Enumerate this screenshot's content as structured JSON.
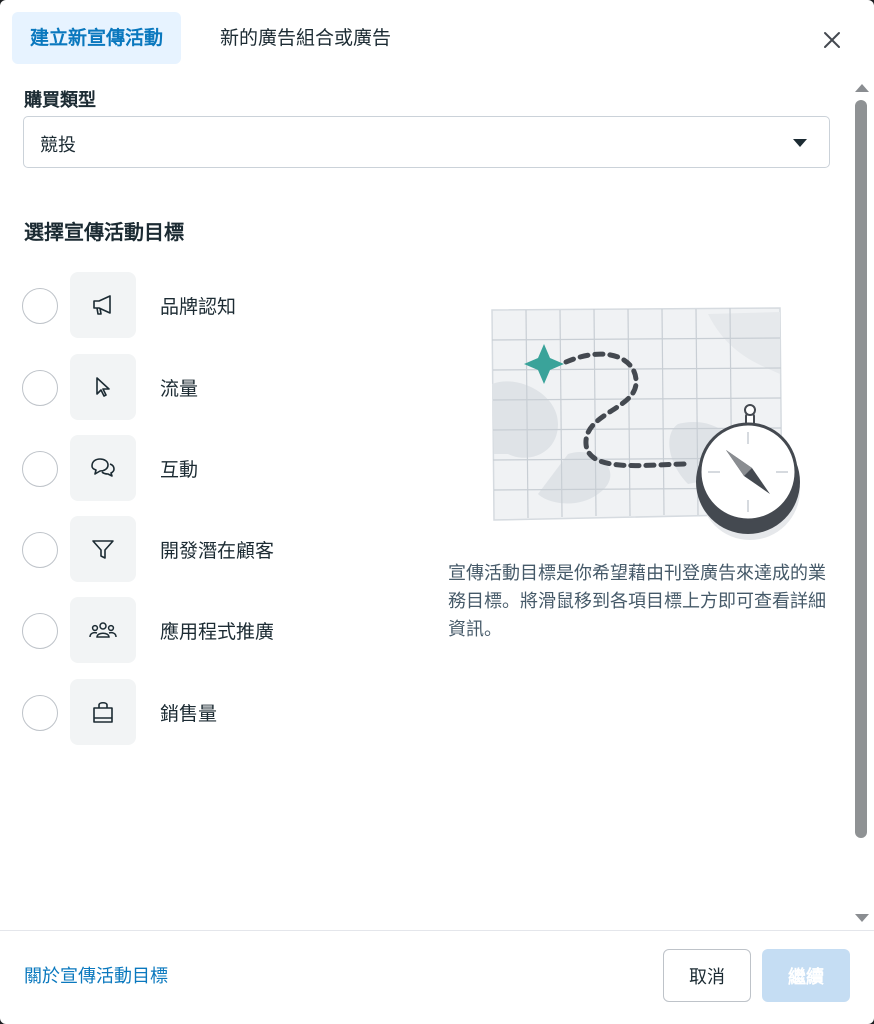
{
  "header": {
    "tabs": [
      {
        "label": "建立新宣傳活動",
        "active": true
      },
      {
        "label": "新的廣告組合或廣告",
        "active": false
      }
    ],
    "close_icon": "close-icon"
  },
  "buying_type": {
    "label": "購買類型",
    "value": "競投"
  },
  "objectives": {
    "heading": "選擇宣傳活動目標",
    "items": [
      {
        "label": "品牌認知",
        "icon": "megaphone-icon"
      },
      {
        "label": "流量",
        "icon": "cursor-icon"
      },
      {
        "label": "互動",
        "icon": "chat-bubbles-icon"
      },
      {
        "label": "開發潛在顧客",
        "icon": "funnel-icon"
      },
      {
        "label": "應用程式推廣",
        "icon": "people-icon"
      },
      {
        "label": "銷售量",
        "icon": "shopping-bag-icon"
      }
    ]
  },
  "info": {
    "description": "宣傳活動目標是你希望藉由刊登廣告來達成的業務目標。將滑鼠移到各項目標上方即可查看詳細資訊。",
    "illustration": "map-compass-illustration"
  },
  "footer": {
    "link": "關於宣傳活動目標",
    "cancel_label": "取消",
    "continue_label": "繼續"
  },
  "colors": {
    "accent": "#0a78be",
    "tab_active_bg": "#e7f3ff",
    "continue_disabled": "#c5ddf3",
    "teal": "#3aa39a"
  }
}
